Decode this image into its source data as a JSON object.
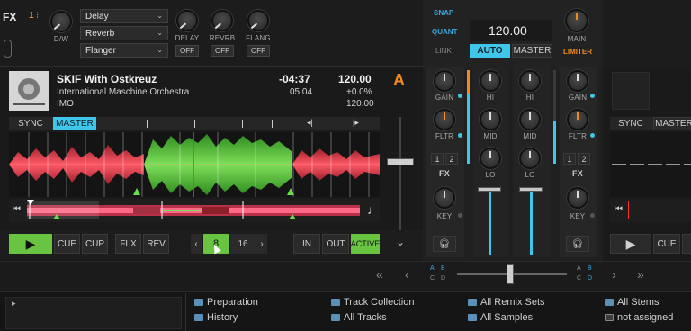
{
  "fx": {
    "label": "FX",
    "unit_number": "1",
    "dw_label": "D/W",
    "slots": [
      "Delay",
      "Reverb",
      "Flanger"
    ],
    "knobs": [
      {
        "label": "DELAY",
        "button": "OFF"
      },
      {
        "label": "REVRB",
        "button": "OFF"
      },
      {
        "label": "FLANG",
        "button": "OFF"
      }
    ]
  },
  "master": {
    "snap": "SNAP",
    "quant": "QUANT",
    "link": "LINK",
    "bpm": "120.00",
    "auto": "AUTO",
    "master": "MASTER",
    "main": "MAIN",
    "limiter": "LIMITER"
  },
  "deck_a": {
    "title": "SKIF With Ostkreuz",
    "artist": "International Maschine Orchestra",
    "label": "IMO",
    "remaining": "-04:37",
    "elapsed": "05:04",
    "bpm": "120.00",
    "pitch": "+0.0%",
    "tempo": "120.00",
    "letter": "A",
    "sync": "SYNC",
    "master": "MASTER",
    "play_icon": "play-icon",
    "cue": "CUE",
    "cup": "CUP",
    "flx": "FLX",
    "rev": "REV",
    "loop_left": "‹",
    "loop_size": "8",
    "loop_next": "16",
    "loop_right": "›",
    "in": "IN",
    "out": "OUT",
    "active": "ACTIVE",
    "chevron": "⌄"
  },
  "mixer": {
    "gain": "GAIN",
    "hi": "HI",
    "mid": "MID",
    "lo": "LO",
    "fltr": "FLTR",
    "fx": "FX",
    "key": "KEY",
    "fx1": "1",
    "fx2": "2"
  },
  "deck_b": {
    "sync": "SYNC",
    "master": "MASTER",
    "cue": "CUE"
  },
  "crossfader": {
    "left_arrows": [
      "«",
      "‹"
    ],
    "right_arrows": [
      "›",
      "»"
    ],
    "abcd_left": [
      "A",
      "B",
      "C",
      "D"
    ],
    "abcd_right": [
      "A",
      "B",
      "C",
      "D"
    ]
  },
  "browser": {
    "items": [
      {
        "label": "Preparation",
        "icon": "folder-icon"
      },
      {
        "label": "History",
        "icon": "folder-icon"
      },
      {
        "label": "Track Collection",
        "icon": "collection-icon"
      },
      {
        "label": "All Tracks",
        "icon": "folder-icon"
      },
      {
        "label": "All Remix Sets",
        "icon": "folder-icon"
      },
      {
        "label": "All Samples",
        "icon": "folder-icon"
      },
      {
        "label": "All Stems",
        "icon": "folder-icon"
      },
      {
        "label": "not assigned",
        "icon": "playlist-icon"
      }
    ],
    "expand": "▸"
  },
  "colors": {
    "accent_orange": "#f08a1e",
    "accent_cyan": "#3ec7ea",
    "accent_green": "#69c441"
  }
}
